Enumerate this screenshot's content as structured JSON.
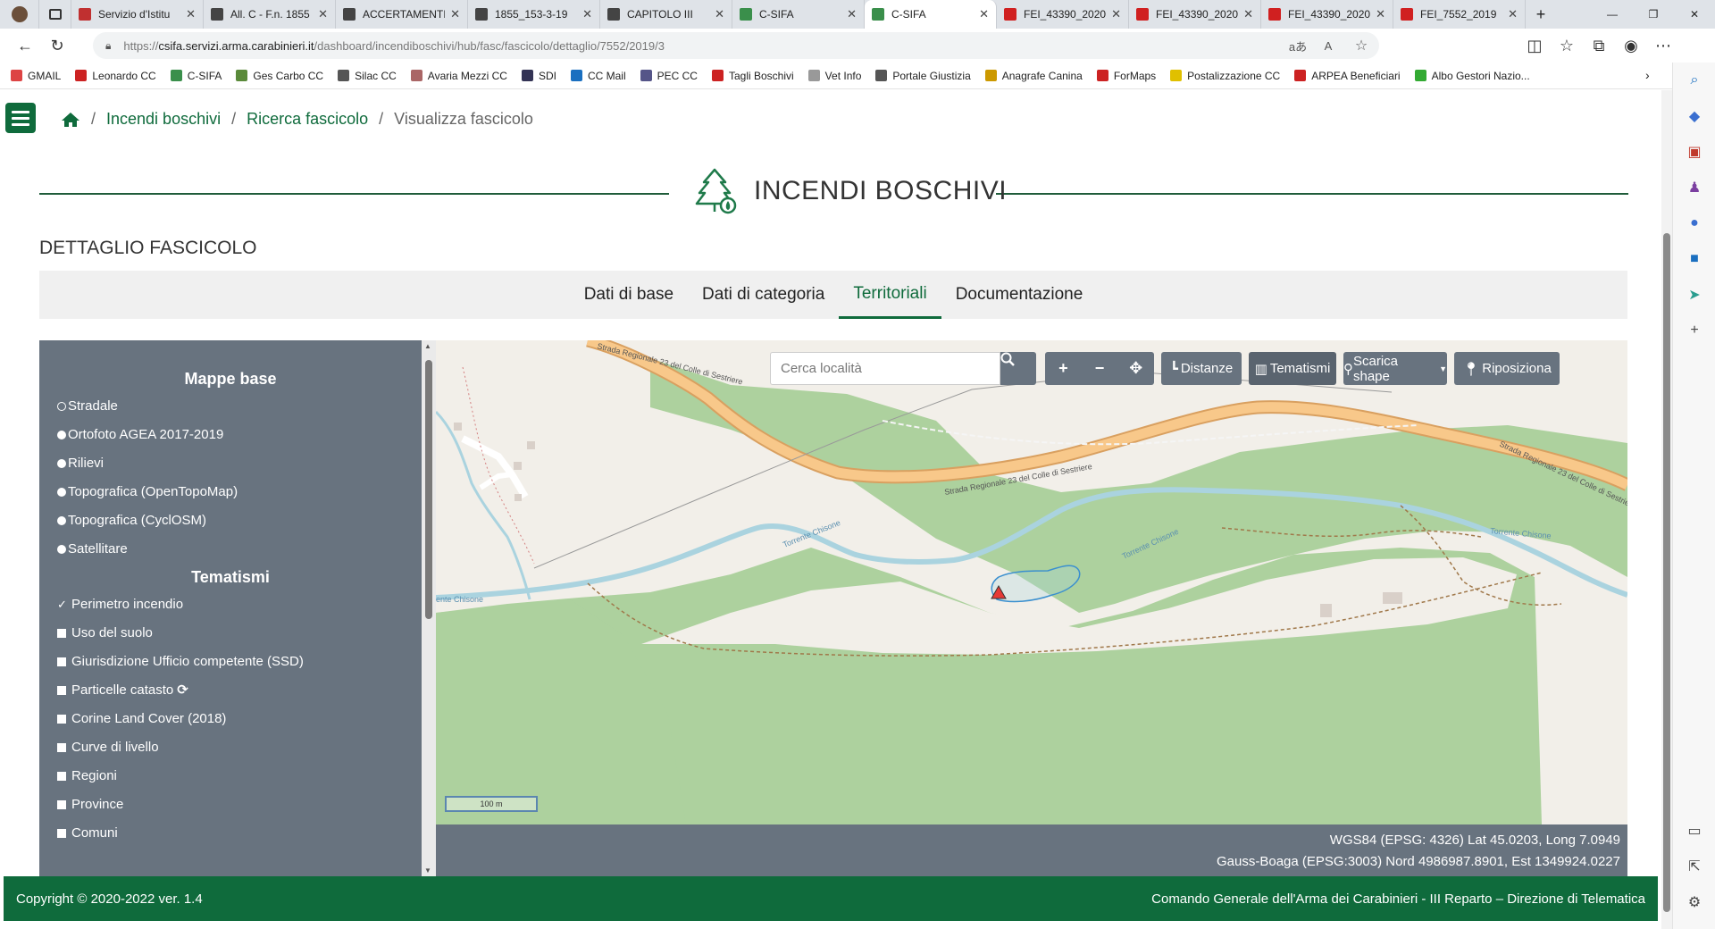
{
  "browser": {
    "tabs": [
      {
        "title": "Servizio d'Istitu",
        "fav": "#c03030",
        "active": false
      },
      {
        "title": "All. C - F.n. 1855",
        "fav": "#444",
        "active": false
      },
      {
        "title": "ACCERTAMENTI",
        "fav": "#444",
        "active": false
      },
      {
        "title": "1855_153-3-19",
        "fav": "#444",
        "active": false
      },
      {
        "title": "CAPITOLO III",
        "fav": "#444",
        "active": false
      },
      {
        "title": "C-SIFA",
        "fav": "#3a8f4b",
        "active": false
      },
      {
        "title": "C-SIFA",
        "fav": "#3a8f4b",
        "active": true
      },
      {
        "title": "FEI_43390_2020",
        "fav": "#d02020",
        "active": false
      },
      {
        "title": "FEI_43390_2020",
        "fav": "#d02020",
        "active": false
      },
      {
        "title": "FEI_43390_2020",
        "fav": "#d02020",
        "active": false
      },
      {
        "title": "FEI_7552_2019",
        "fav": "#d02020",
        "active": false
      }
    ],
    "url_prefix": "https://",
    "url_host": "csifa.servizi.arma.carabinieri.it",
    "url_path": "/dashboard/incendiboschivi/hub/fasc/fascicolo/dettaglio/7552/2019/3",
    "bookmarks": [
      {
        "label": "GMAIL",
        "color": "#d44"
      },
      {
        "label": "Leonardo CC",
        "color": "#c22"
      },
      {
        "label": "C-SIFA",
        "color": "#3a8f4b"
      },
      {
        "label": "Ges Carbo CC",
        "color": "#5a8a3a"
      },
      {
        "label": "Silac CC",
        "color": "#555"
      },
      {
        "label": "Avaria Mezzi CC",
        "color": "#a66"
      },
      {
        "label": "SDI",
        "color": "#335"
      },
      {
        "label": "CC Mail",
        "color": "#1a6fc0"
      },
      {
        "label": "PEC CC",
        "color": "#558"
      },
      {
        "label": "Tagli Boschivi",
        "color": "#c22"
      },
      {
        "label": "Vet Info",
        "color": "#999"
      },
      {
        "label": "Portale Giustizia",
        "color": "#555"
      },
      {
        "label": "Anagrafe Canina",
        "color": "#c90"
      },
      {
        "label": "ForMaps",
        "color": "#c22"
      },
      {
        "label": "Postalizzazione CC",
        "color": "#e0c000"
      },
      {
        "label": "ARPEA Beneficiari",
        "color": "#c22"
      },
      {
        "label": "Albo Gestori Nazio...",
        "color": "#3a3"
      }
    ]
  },
  "breadcrumb": {
    "items": [
      "Incendi boschivi",
      "Ricerca fascicolo",
      "Visualizza fascicolo"
    ]
  },
  "page": {
    "title": "INCENDI BOSCHIVI",
    "subtitle": "DETTAGLIO FASCICOLO"
  },
  "tabs": [
    {
      "label": "Dati di base",
      "active": false
    },
    {
      "label": "Dati di categoria",
      "active": false
    },
    {
      "label": "Territoriali",
      "active": true
    },
    {
      "label": "Documentazione",
      "active": false
    }
  ],
  "layers": {
    "base_heading": "Mappe base",
    "base_maps": [
      {
        "label": "Stradale",
        "selected": false
      },
      {
        "label": "Ortofoto AGEA 2017-2019",
        "selected": true
      },
      {
        "label": "Rilievi",
        "selected": true
      },
      {
        "label": "Topografica (OpenTopoMap)",
        "selected": true
      },
      {
        "label": "Topografica (CyclOSM)",
        "selected": true
      },
      {
        "label": "Satellitare",
        "selected": true
      }
    ],
    "theme_heading": "Tematismi",
    "themes": [
      {
        "label": "Perimetro incendio",
        "checked": true
      },
      {
        "label": "Uso del suolo",
        "checked": false
      },
      {
        "label": "Giurisdizione Ufficio competente (SSD)",
        "checked": false
      },
      {
        "label": "Particelle catasto",
        "checked": false,
        "extra_icon": "refresh-icon"
      },
      {
        "label": "Corine Land Cover (2018)",
        "checked": false
      },
      {
        "label": "Curve di livello",
        "checked": false
      },
      {
        "label": "Regioni",
        "checked": false
      },
      {
        "label": "Province",
        "checked": false
      },
      {
        "label": "Comuni",
        "checked": false
      }
    ]
  },
  "map": {
    "search_placeholder": "Cerca località",
    "distances_label": "Distanze",
    "themes_label": "Tematismi",
    "download_label": "Scarica shape",
    "reposition_label": "Riposiziona",
    "scale_label": "100 m",
    "road_label_1": "Strada Regionale 23 del Colle di Sestriere",
    "road_label_2": "Strada Regionale 23 del Colle di Sestriere",
    "road_label_3": "Strada Regionale 23 del Colle di Sestriere",
    "river_label_1": "Torrente Chisone",
    "river_label_2": "Torrente Chisone",
    "river_label_3": "Torrente Chisone",
    "river_label_4": "ente Chisone",
    "colors": {
      "forest": "#add19e",
      "land": "#f2efe9",
      "road": "#f8c88a",
      "road_border": "#d9a060",
      "river": "#aad3df",
      "fire": "#e53935"
    }
  },
  "coords": {
    "wgs84": "WGS84 (EPSG: 4326) Lat 45.0203, Long 7.0949",
    "gauss": "Gauss-Boaga (EPSG:3003) Nord 4986987.8901, Est 1349924.0227"
  },
  "footer": {
    "copyright": "Copyright © 2020-2022 ver. 1.4",
    "org": "Comando Generale dell'Arma dei Carabinieri - III Reparto – Direzione di Telematica"
  }
}
